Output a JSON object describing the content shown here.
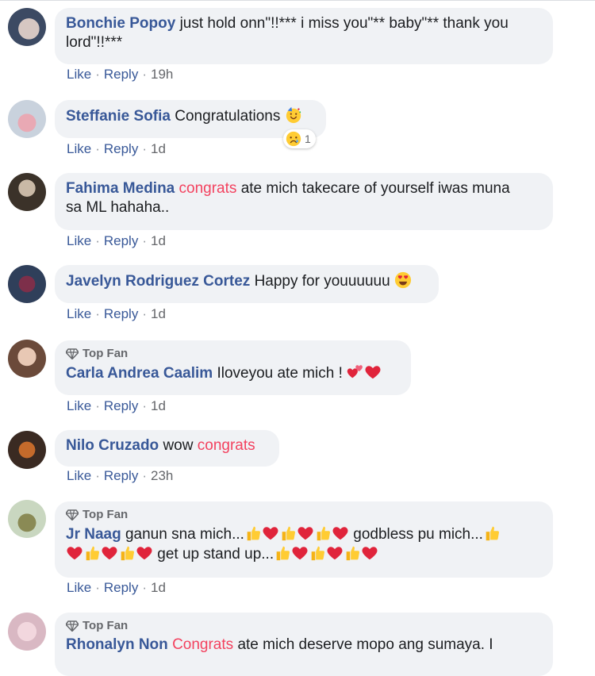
{
  "actions": {
    "like": "Like",
    "reply": "Reply",
    "sep": "·"
  },
  "top_fan_label": "Top Fan",
  "comments": [
    {
      "name": "Bonchie Popoy",
      "text1": "just hold onn\"!!*** i miss you\"** baby\"** thank you",
      "text2": "lord\"!!***",
      "time": "19h"
    },
    {
      "name": "Steffanie Sofia",
      "text1": "Congratulations",
      "reaction_count": "1",
      "time": "1d"
    },
    {
      "name": "Fahima Medina",
      "highlight": "congrats",
      "text1": "ate mich takecare of yourself iwas muna",
      "text2": "sa ML hahaha..",
      "time": "1d"
    },
    {
      "name": "Javelyn Rodriguez Cortez",
      "text1": "Happy for youuuuuu",
      "time": "1d"
    },
    {
      "name": "Carla Andrea Caalim",
      "text1": "Iloveyou ate mich !",
      "time": "1d"
    },
    {
      "name": "Nilo Cruzado",
      "text1": "wow",
      "highlight": "congrats",
      "time": "23h"
    },
    {
      "name": "Jr Naag",
      "text1": "ganun sna mich...",
      "text2": "godbless pu mich...",
      "text3": "get up stand up...",
      "time": "1d"
    },
    {
      "name": "Rhonalyn Non",
      "highlight": "Congrats",
      "text1": "ate mich deserve mopo ang sumaya. I"
    }
  ],
  "colors": {
    "name": "#385898",
    "highlight": "#f3425f",
    "bubble": "#f0f2f5",
    "link": "#385898"
  }
}
